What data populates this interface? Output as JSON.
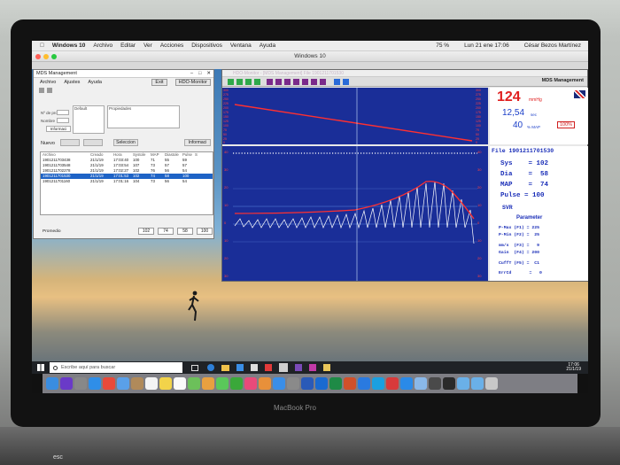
{
  "mac_menu": {
    "app": "Windows 10",
    "items": [
      "Archivo",
      "Editar",
      "Ver",
      "Acciones",
      "Dispositivos",
      "Ventana",
      "Ayuda"
    ],
    "battery": "75 %",
    "datetime": "Lun 21 ene 17:06",
    "user": "César Bezos Martínez"
  },
  "vm": {
    "title": "Windows 10"
  },
  "mds": {
    "title": "MDS Management",
    "menu": [
      "Archivo",
      "Ajustes",
      "Ayuda"
    ],
    "exit_label": "Exit",
    "hdo_label": "HDO-Monitor",
    "field_labels": [
      "Nº de pron",
      "Nombre"
    ],
    "info_label": "Informaci",
    "default_label": "Default",
    "properties_label": "Propiedades",
    "nuevo_label": "Nuevo",
    "seleccion_label": "Seleccion",
    "informacion_label": "Informaci",
    "table_headers": [
      "Archivo",
      "Creado",
      "Hora",
      "Systole",
      "MAP",
      "Diastole",
      "Pulse",
      "S"
    ],
    "rows": [
      [
        "1901211703438",
        "21/1/19",
        "17:03:40",
        "100",
        "71",
        "55",
        "59"
      ],
      [
        "1901211703548",
        "21/1/19",
        "17:03:54",
        "107",
        "73",
        "57",
        "57"
      ],
      [
        "1901211702278",
        "21/1/19",
        "17:02:27",
        "102",
        "76",
        "56",
        "54"
      ],
      [
        "1901211701530",
        "21/1/19",
        "17:01:53",
        "102",
        "74",
        "58",
        "100"
      ],
      [
        "1901211701160",
        "21/1/19",
        "17:01:16",
        "104",
        "73",
        "56",
        "54"
      ]
    ],
    "promedio_label": "Promedio",
    "averages": [
      "102",
      "74",
      "58",
      "100"
    ]
  },
  "hdo": {
    "title": "HDO-Monitor - [MDS Management] File 1901211701530",
    "brand": "MDS Management",
    "systolic": "124",
    "systolic_unit": "mmHg",
    "value2": "12,54",
    "value2_unit": "sec",
    "map_pct": "40",
    "map_unit": "% MAP",
    "pct_box": "100%",
    "file_label": "File 1901211701530",
    "sys": "Sys    = 102",
    "dia": "Dia    =  58",
    "map": "MAP    =  74",
    "pulse": "Pulse = 100",
    "svr": "SVR",
    "parameter_title": "Parameter",
    "p_max": "P-Max (F1) = 225",
    "p_min": "P-Min (F2) =  25",
    "mms": "mm/s  (F3) =   9",
    "gain": "Gain  (F4) = 200",
    "cuff": "CuffT (F5) =  C1",
    "err": "ErrCd       =   0",
    "trend_ticks": [
      "300",
      "275",
      "250",
      "225",
      "200",
      "175",
      "150",
      "125",
      "100",
      "75",
      "50",
      "25",
      "0"
    ],
    "wave_ticks": [
      "40",
      "30",
      "20",
      "10",
      "0",
      "10",
      "20",
      "30"
    ]
  },
  "taskbar": {
    "search_placeholder": "Escribe aquí para buscar",
    "time": "17:06",
    "date": "21/1/19"
  },
  "laptop_label": "MacBook Pro",
  "key_label": "esc"
}
